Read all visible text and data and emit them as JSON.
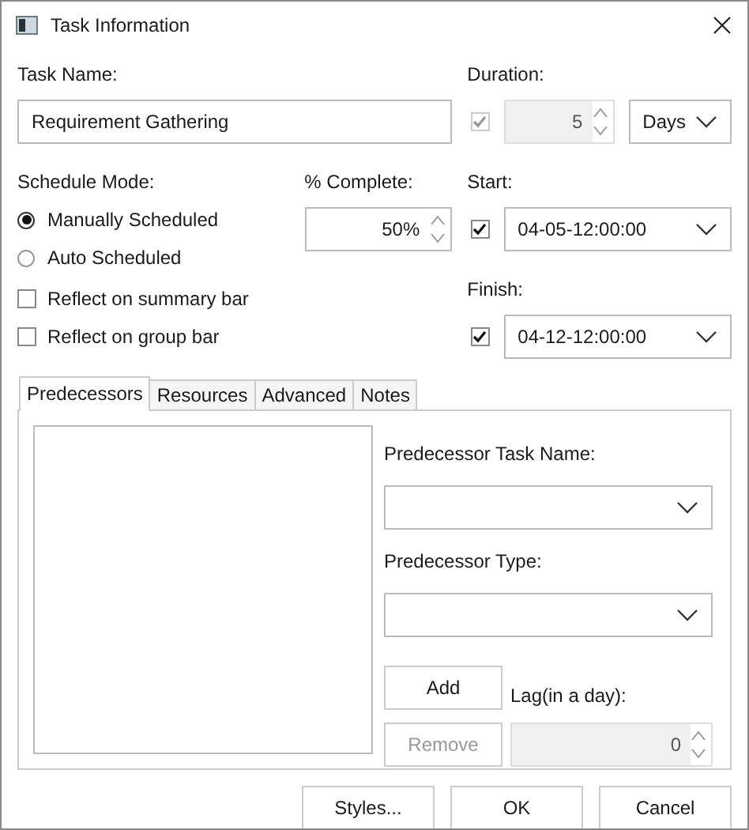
{
  "window": {
    "title": "Task Information"
  },
  "task_name": {
    "label": "Task Name:",
    "value": "Requirement Gathering"
  },
  "duration": {
    "label": "Duration:",
    "checked": true,
    "disabled": true,
    "value": "5",
    "unit": "Days"
  },
  "schedule_mode": {
    "label": "Schedule Mode:",
    "options": [
      {
        "label": "Manually Scheduled",
        "selected": true
      },
      {
        "label": "Auto Scheduled",
        "selected": false
      }
    ]
  },
  "percent_complete": {
    "label": "% Complete:",
    "value": "50%"
  },
  "start": {
    "label": "Start:",
    "checked": true,
    "value": "04-05-12:00:00"
  },
  "finish": {
    "label": "Finish:",
    "checked": true,
    "value": "04-12-12:00:00"
  },
  "options": [
    {
      "label": "Reflect on summary bar",
      "checked": false
    },
    {
      "label": "Reflect on group bar",
      "checked": false
    }
  ],
  "tabs": [
    {
      "label": "Predecessors",
      "selected": true
    },
    {
      "label": "Resources",
      "selected": false
    },
    {
      "label": "Advanced",
      "selected": false
    },
    {
      "label": "Notes",
      "selected": false
    }
  ],
  "predecessors": {
    "task_name_label": "Predecessor Task Name:",
    "type_label": "Predecessor Type:",
    "add": {
      "label": "Add",
      "disabled": false
    },
    "remove": {
      "label": "Remove",
      "disabled": true
    },
    "lag": {
      "label": "Lag(in a day):",
      "value": "0",
      "disabled": true
    }
  },
  "buttons": [
    "Styles...",
    "OK",
    "Cancel"
  ]
}
